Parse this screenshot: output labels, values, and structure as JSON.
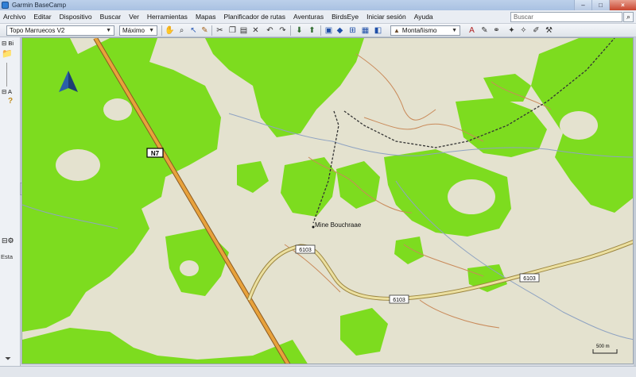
{
  "window": {
    "title": "Garmin BaseCamp",
    "minimize": "–",
    "maximize": "□",
    "close": "×"
  },
  "menu": {
    "items": [
      "Archivo",
      "Editar",
      "Dispositivo",
      "Buscar",
      "Ver",
      "Herramientas",
      "Mapas",
      "Planificador de rutas",
      "Aventuras",
      "BirdsEye",
      "Iniciar sesión",
      "Ayuda"
    ],
    "search_placeholder": "Buscar",
    "search_icon": "search-icon"
  },
  "toolbar": {
    "map_product": "Topo Marruecos V2",
    "detail_level": "Máximo",
    "profile": "Montañismo",
    "icons": [
      "hand-icon",
      "zoom-icon",
      "select-icon",
      "measure-icon",
      "cut-icon",
      "copy-icon",
      "paste-icon",
      "delete-icon",
      "undo-icon",
      "redo-icon",
      "receive-icon",
      "send-icon",
      "view-2d-icon",
      "view-3d-icon",
      "fit-icon",
      "grid-icon",
      "profile-icon",
      "route-icon"
    ]
  },
  "left_panel": {
    "section1_label": "Bi",
    "section2_label": "A",
    "status_label": "Esta",
    "colors": {
      "panel": "#eef1f5"
    }
  },
  "map": {
    "road_labels": [
      {
        "id": "N7",
        "text": "N7"
      },
      {
        "id": "6103-a",
        "text": "6103"
      },
      {
        "id": "6103-b",
        "text": "6103"
      },
      {
        "id": "6103-c",
        "text": "6103"
      }
    ],
    "place_label": "Mine Bouchraae",
    "scale_label": "500 m",
    "colors": {
      "terrain": "#e4e2cf",
      "vegetation": "#7ddc1f",
      "road_primary": "#e8a23c",
      "road_secondary": "#e8d27a",
      "contour": "#c98a5a",
      "boundary": "#8fa3c2"
    }
  }
}
